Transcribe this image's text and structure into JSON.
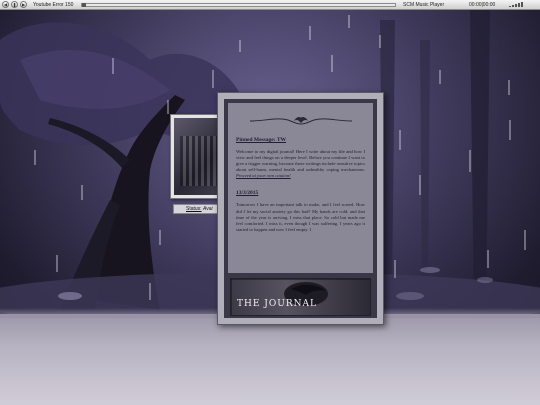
{
  "player": {
    "track_status": "Youtube Error 150",
    "app_name": "SCM Music Player",
    "time": "00:00|00:00",
    "controls": [
      "previous",
      "play-pause",
      "next"
    ]
  },
  "status_window": {
    "label": "Status:",
    "value": "Avai"
  },
  "journal": {
    "pinned_heading": "Pinned Message: TW",
    "pinned_body": "Welcome to my digital journal! Here I write about my life and how I view and feel things on a deeper level. Before you continue I want to give a trigger warning, because these writings include sensitive topics about self-harm, mental health and unhealthy coping mechanisms.",
    "pinned_link": "Proceed at your own caution!",
    "entry_date": "13/3/2015",
    "entry_body": "Tomorrow I have an important talk to make, and I feel scared. How did I let my social anxiety go this bad? My hands are cold, and that time of the year is arriving. I miss that place. So cold but made me feel comforted. I miss it, even though I was suffering. I years ago it started to happen and now I feel empty. I",
    "banner_title": "THE JOURNAL"
  },
  "colors": {
    "sky": "#2c2845",
    "journal_paper": "#8a8796",
    "floor": "#b7b2c1"
  }
}
